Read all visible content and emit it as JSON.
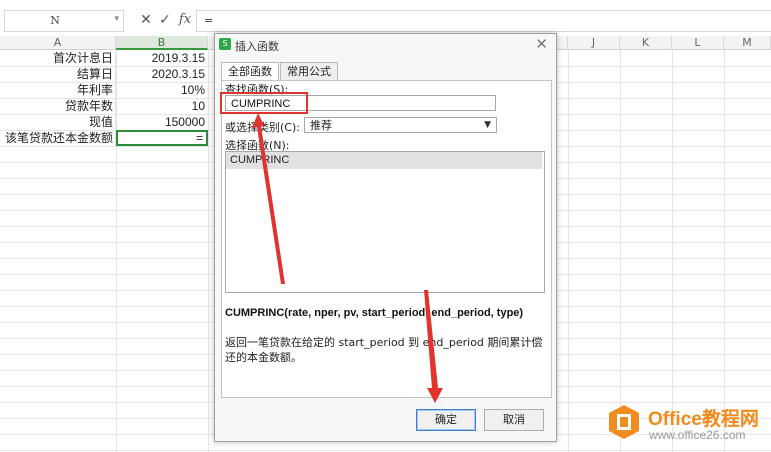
{
  "formula_bar": {
    "name_box": "N",
    "cancel_icon": "close-icon",
    "confirm_icon": "check-icon",
    "fx_label": "fx",
    "formula": "="
  },
  "columns": [
    "A",
    "B",
    "J",
    "K",
    "L",
    "M"
  ],
  "rows": [
    {
      "label": "首次计息日",
      "value": "2019.3.15"
    },
    {
      "label": "结算日",
      "value": "2020.3.15"
    },
    {
      "label": "年利率",
      "value": "10%"
    },
    {
      "label": "贷款年数",
      "value": "10"
    },
    {
      "label": "现值",
      "value": "150000"
    },
    {
      "label": "该笔贷款还本金数额",
      "value": "="
    }
  ],
  "dialog": {
    "title": "插入函数",
    "tabs": [
      "全部函数",
      "常用公式"
    ],
    "search_label": "查找函数(S):",
    "search_value": "CUMPRINC",
    "category_label": "或选择类别(C):",
    "category_value": "推荐",
    "list_label": "选择函数(N):",
    "list_items": [
      "CUMPRINC"
    ],
    "syntax": "CUMPRINC(rate, nper, pv, start_period, end_period, type)",
    "description": "返回一笔贷款在给定的 start_period 到 end_period 期间累计偿还的本金数额。",
    "ok": "确定",
    "cancel": "取消"
  },
  "watermark": {
    "brand": "Office教程网",
    "url": "www.office26.com"
  },
  "colors": {
    "accent_green": "#2e8b3a",
    "highlight_red": "#e2342e",
    "watermark_orange": "#f28b1e"
  }
}
